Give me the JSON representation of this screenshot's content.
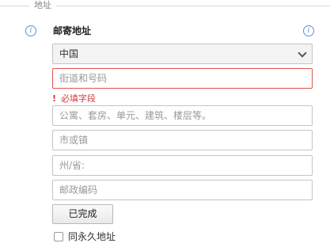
{
  "legend": "地址",
  "section_title": "邮寄地址",
  "country": {
    "selected": "中国"
  },
  "street": {
    "placeholder": "街道和号码"
  },
  "error": {
    "mark": "!",
    "message": "必填字段"
  },
  "apartment": {
    "placeholder": "公寓、套房、单元、建筑、楼层等。"
  },
  "city": {
    "placeholder": "市或镇"
  },
  "state": {
    "placeholder": "州/省:"
  },
  "postal": {
    "placeholder": "邮政编码"
  },
  "done_button": "已完成",
  "same_address_label": "同永久地址",
  "colors": {
    "error": "#e0524f",
    "info": "#5b8fd6"
  },
  "icons": {
    "info": "info-icon",
    "dropdown": "chevron-down-icon"
  }
}
